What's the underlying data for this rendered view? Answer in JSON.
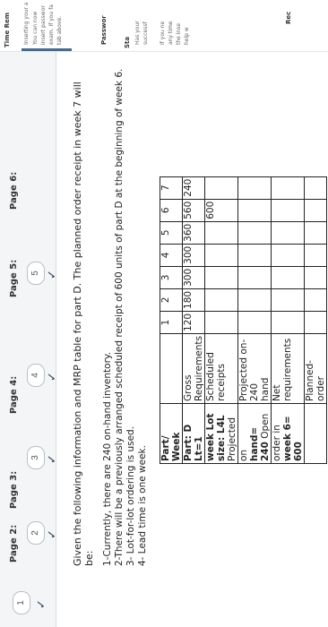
{
  "nav": {
    "items": [
      {
        "number": "1",
        "label": ""
      },
      {
        "number": "2",
        "label": "Page 2:"
      },
      {
        "number": "3",
        "label": "Page 3:"
      },
      {
        "number": "4",
        "label": "Page 4:"
      },
      {
        "number": "5",
        "label": "Page 5:"
      },
      {
        "number": "",
        "label": "Page 6:"
      }
    ],
    "check": "✓"
  },
  "question": {
    "intro": "Given the following information and MRP table for part D. The planned order receipt in week 7 will be:",
    "items": [
      "1-Currently, there are 240 on-hand inventory.",
      "2-There will be a previously arranged scheduled receipt of 600 units of part D at the beginning of week 6.",
      "3- Lot-for-lot ordering is used.",
      "4- Lead time is one week."
    ]
  },
  "table": {
    "left_header": [
      "Part/ Week",
      "Part: D  Lt=1",
      "week Lot",
      "size: L4L",
      "on",
      "hand= 240",
      "order in",
      "week 6= 600"
    ],
    "left_bold": [
      true,
      true,
      true,
      false,
      false,
      false,
      false,
      false
    ],
    "left_pieces": {
      "r2": "Projected",
      "r4": "Open",
      "r6": ""
    },
    "weeks": [
      "1",
      "2",
      "3",
      "4",
      "5",
      "6",
      "7"
    ],
    "row_labels": [
      "Gross",
      "Requirements",
      "Scheduled",
      "receipts",
      "Projected on-",
      "hand",
      "Net",
      "requirements",
      "Planned-",
      "order"
    ],
    "gross": [
      "120",
      "180",
      "300",
      "300",
      "360",
      "560",
      "240"
    ],
    "scheduled": [
      "",
      "",
      "",
      "",
      "",
      "600",
      ""
    ],
    "projected_first": "240"
  },
  "right_panel": {
    "header": "Time Rem",
    "lines": [
      "Inserting your a",
      "You can now",
      "insert passwor",
      "exam. If you fa",
      "tab above."
    ],
    "password": "Passwor",
    "s_title": "Sta",
    "s_lines": [
      "Has your",
      "successf",
      "If you ne",
      "any time",
      "the inse",
      "help w"
    ],
    "rec": "Rec"
  }
}
